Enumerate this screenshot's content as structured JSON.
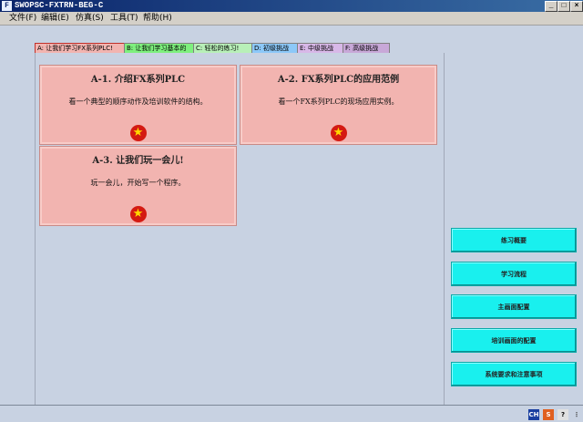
{
  "window": {
    "title": "SWOPSC-FXTRN-BEG-C",
    "app_icon_glyph": "F",
    "controls": [
      "_",
      "□",
      "×"
    ]
  },
  "menu": [
    "文件(F)",
    "编辑(E)",
    "仿真(S)",
    "工具(T)",
    "帮助(H)"
  ],
  "tabs": [
    {
      "label": "A: 让我们学习FX系列PLC!",
      "color": "#f2b4b0",
      "active": true
    },
    {
      "label": "B: 让我们学习基本的",
      "color": "#7ef07e",
      "active": false
    },
    {
      "label": "C: 轻松的练习!",
      "color": "#b8f0b8",
      "active": false
    },
    {
      "label": "D: 初级挑战",
      "color": "#8cc8f8",
      "active": false
    },
    {
      "label": "E: 中级挑战",
      "color": "#d8b8e8",
      "active": false
    },
    {
      "label": "F: 高级挑战",
      "color": "#c8a8d8",
      "active": false
    }
  ],
  "lessons": [
    {
      "title": "A-1. 介绍FX系列PLC",
      "desc": "看一个典型的顺序动作及培训软件的结构。",
      "icon": "star-icon"
    },
    {
      "title": "A-2. FX系列PLC的应用范例",
      "desc": "看一个FX系列PLC的现场应用实例。",
      "icon": "star-icon"
    },
    {
      "title": "A-3. 让我们玩一会儿!",
      "desc": "玩一会儿，开始写一个程序。",
      "icon": "star-icon"
    }
  ],
  "side_buttons": [
    "练习概要",
    "学习流程",
    "主画面配置",
    "培训画面的配置",
    "系统要求和注意事项"
  ],
  "tray": [
    {
      "glyph": "CH",
      "bg": "#1a3fa0",
      "fg": "#ffffff"
    },
    {
      "glyph": "S",
      "bg": "#e06020",
      "fg": "#ffffff"
    },
    {
      "glyph": "?",
      "bg": "#e0e0e0",
      "fg": "#000000"
    },
    {
      "glyph": "⋮",
      "bg": "#c8d2e2",
      "fg": "#444444"
    }
  ]
}
